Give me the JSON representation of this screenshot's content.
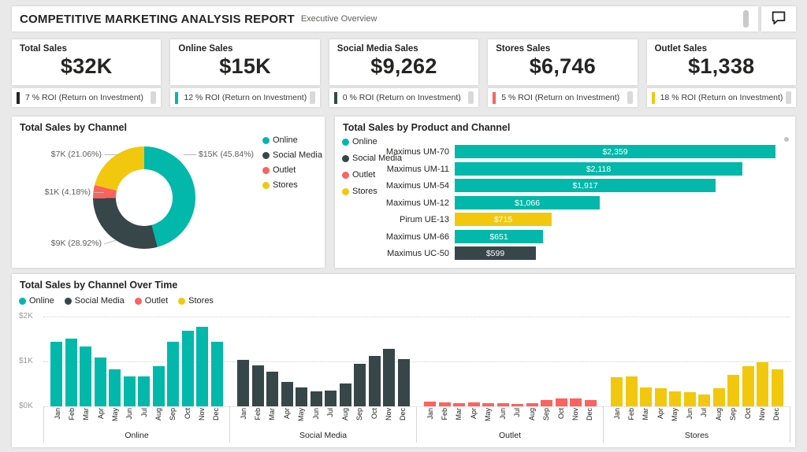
{
  "header": {
    "title": "COMPETITIVE MARKETING ANALYSIS REPORT",
    "subtitle": "Executive Overview"
  },
  "colors": {
    "online": "#01B8AA",
    "social_media": "#374649",
    "outlet": "#FD625E",
    "stores": "#F2C80F",
    "kpi_total": "#252423"
  },
  "channel_colors": {
    "Online": "#01B8AA",
    "Social Media": "#374649",
    "Outlet": "#FD625E",
    "Stores": "#F2C80F"
  },
  "kpi_cards": [
    {
      "title": "Total Sales",
      "value": "$32K",
      "roi": "7 % ROI (Return on Investment)",
      "color": "#252423"
    },
    {
      "title": "Online Sales",
      "value": "$15K",
      "roi": "12 % ROI (Return on Investment)",
      "color": "#01B8AA"
    },
    {
      "title": "Social Media Sales",
      "value": "$9,262",
      "roi": "0 % ROI (Return on Investment)",
      "color": "#374649"
    },
    {
      "title": "Stores Sales",
      "value": "$6,746",
      "roi": "5 % ROI (Return on Investment)",
      "color": "#FD625E"
    },
    {
      "title": "Outlet Sales",
      "value": "$1,338",
      "roi": "18 % ROI (Return on Investment)",
      "color": "#F2C80F"
    }
  ],
  "chart_data": [
    {
      "type": "pie",
      "title": "Total Sales by Channel",
      "donut": true,
      "legend_position": "right",
      "legend": [
        "Online",
        "Social Media",
        "Outlet",
        "Stores"
      ],
      "slices": [
        {
          "label": "Online",
          "value_text": "$15K",
          "percent": 45.84,
          "color": "#01B8AA",
          "callout": "$15K (45.84%)"
        },
        {
          "label": "Social Media",
          "value_text": "$9K",
          "percent": 28.92,
          "color": "#374649",
          "callout": "$9K (28.92%)"
        },
        {
          "label": "Outlet",
          "value_text": "$1K",
          "percent": 4.18,
          "color": "#FD625E",
          "callout": "$1K (4.18%)"
        },
        {
          "label": "Stores",
          "value_text": "$7K",
          "percent": 21.06,
          "color": "#F2C80F",
          "callout": "$7K (21.06%)"
        }
      ]
    },
    {
      "type": "bar",
      "title": "Total Sales by Product and Channel",
      "orientation": "horizontal",
      "legend_position": "left",
      "legend": [
        "Online",
        "Social Media",
        "Outlet",
        "Stores"
      ],
      "categories": [
        "Maximus UM-70",
        "Maximus UM-11",
        "Maximus UM-54",
        "Maximus UM-12",
        "Pirum UE-13",
        "Maximus UM-66",
        "Maximus UC-50"
      ],
      "values": [
        2359,
        2118,
        1917,
        1066,
        715,
        651,
        599
      ],
      "value_labels": [
        "$2,359",
        "$2,118",
        "$1,917",
        "$1,066",
        "$715",
        "$651",
        "$599"
      ],
      "channels": [
        "Online",
        "Online",
        "Online",
        "Online",
        "Stores",
        "Online",
        "Social Media"
      ],
      "xlim": [
        0,
        2400
      ]
    },
    {
      "type": "bar",
      "title": "Total Sales by Channel Over Time",
      "legend_position": "top",
      "legend": [
        "Online",
        "Social Media",
        "Outlet",
        "Stores"
      ],
      "categories": [
        "Jan",
        "Feb",
        "Mar",
        "Apr",
        "May",
        "Jun",
        "Jul",
        "Aug",
        "Sep",
        "Oct",
        "Nov",
        "Dec"
      ],
      "y_ticks": [
        "$2K",
        "$1K",
        "$0K"
      ],
      "ylim": [
        0,
        2000
      ],
      "grid": "dotted",
      "series": [
        {
          "name": "Online",
          "values": [
            1440,
            1500,
            1340,
            1090,
            820,
            660,
            660,
            900,
            1440,
            1690,
            1770,
            1440
          ]
        },
        {
          "name": "Social Media",
          "values": [
            1030,
            920,
            780,
            550,
            420,
            330,
            350,
            500,
            950,
            1130,
            1280,
            1060
          ]
        },
        {
          "name": "Outlet",
          "values": [
            110,
            95,
            75,
            95,
            75,
            65,
            55,
            75,
            135,
            175,
            175,
            145
          ]
        },
        {
          "name": "Stores",
          "values": [
            650,
            660,
            420,
            400,
            330,
            310,
            260,
            400,
            710,
            890,
            990,
            830
          ]
        }
      ]
    }
  ]
}
